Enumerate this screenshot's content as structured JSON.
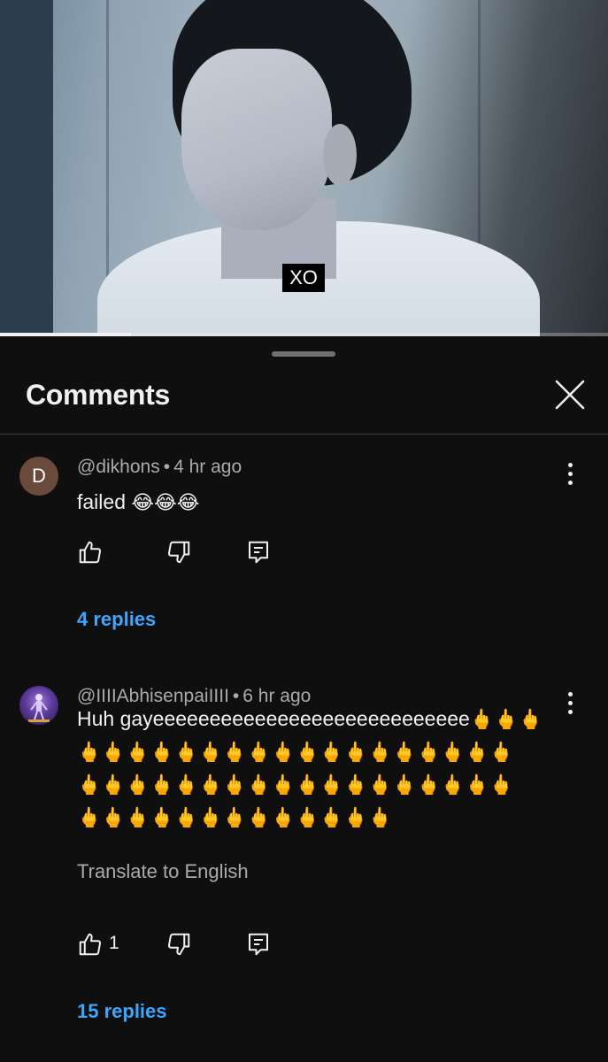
{
  "video": {
    "caption": "XO",
    "progress_fraction": 0.215
  },
  "sheet": {
    "title": "Comments"
  },
  "comments": [
    {
      "avatar_letter": "D",
      "author": "@dikhons",
      "separator": "•",
      "time": "4 hr ago",
      "text": "failed",
      "emoji": "😂😂😂",
      "replies": "4 replies"
    },
    {
      "author": "@IIIIAbhisenpaiIIII",
      "separator": "•",
      "time": "6 hr ago",
      "text": "Huh gayeeeeeeeeeeeeeeeeeeeeeeeeeeee",
      "emoji_line1": "🖕🖕🖕",
      "emoji_line2": "🖕🖕🖕🖕🖕🖕🖕🖕🖕🖕🖕🖕🖕🖕🖕🖕🖕🖕",
      "emoji_line3": "🖕🖕🖕🖕🖕🖕🖕🖕🖕🖕🖕🖕🖕🖕🖕🖕🖕🖕",
      "emoji_line4": "🖕🖕🖕🖕🖕🖕🖕🖕🖕🖕🖕🖕🖕",
      "translate": "Translate to English",
      "likes": "1",
      "replies": "15 replies"
    }
  ],
  "icons": {
    "like": "thumbs-up-icon",
    "dislike": "thumbs-down-icon",
    "reply": "reply-icon",
    "more": "more-vertical-icon",
    "close": "close-icon"
  },
  "colors": {
    "background": "#0f0f0f",
    "link": "#3ea6ff",
    "secondary_text": "#aaaaaa",
    "avatar_d": "#6a4a3b"
  }
}
